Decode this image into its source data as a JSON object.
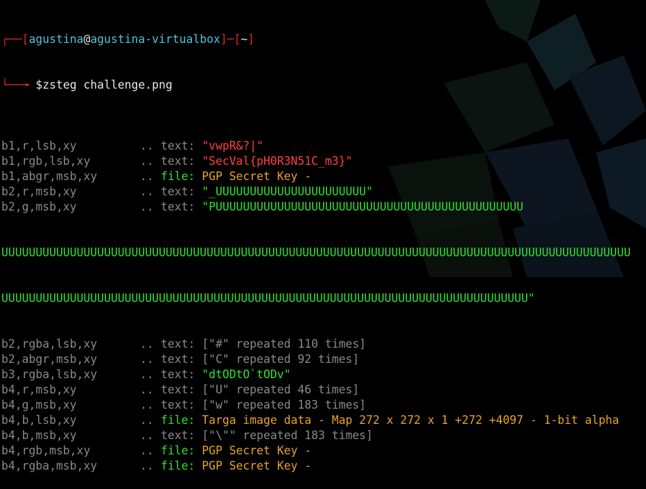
{
  "prompt": {
    "open": "┌──[",
    "user": "agustina",
    "at": "@",
    "host": "agustina-virtualbox",
    "mid": "]─[",
    "dir": "~",
    "close": "]",
    "branch": "└──╼ ",
    "symbol": "$",
    "command": "zsteg challenge.png"
  },
  "rows": [
    {
      "sig": "b1,r,lsb,xy",
      "dots": "..",
      "type": "text:",
      "value": "\"vwpR&?|\"",
      "vcolor": "pred"
    },
    {
      "sig": "b1,rgb,lsb,xy",
      "dots": "..",
      "type": "text:",
      "value": "\"SecVal{pH0R3N51C_m3}\"",
      "vcolor": "pred"
    },
    {
      "sig": "b1,abgr,msb,xy",
      "dots": "..",
      "type": "file:",
      "value": "PGP Secret Key -",
      "vcolor": "orange"
    },
    {
      "sig": "b2,r,msb,xy",
      "dots": "..",
      "type": "text:",
      "value": "\"_UUUUUUUUUUUUUUUUUUUUUU\"",
      "vcolor": "green"
    },
    {
      "sig": "b2,g,msb,xy",
      "dots": "..",
      "type": "text:",
      "value": "\"PUUUUUUUUUUUUUUUUUUUUUUUUUUUUUUUUUUUUUUUUUUUUU",
      "vcolor": "green"
    }
  ],
  "wrap": [
    "UUUUUUUUUUUUUUUUUUUUUUUUUUUUUUUUUUUUUUUUUUUUUUUUUUUUUUUUUUUUUUUUUUUUUUUUUUUUUUUUUUUUUUUUUUUU",
    "UUUUUUUUUUUUUUUUUUUUUUUUUUUUUUUUUUUUUUUUUUUUUUUUUUUUUUUUUUUUUUUUUUUUUUUUUUUUU\""
  ],
  "rows2": [
    {
      "sig": "b2,rgba,lsb,xy",
      "dots": "..",
      "type": "text:",
      "value": "[\"#\" repeated 110 times]",
      "vcolor": "grey"
    },
    {
      "sig": "b2,abgr,msb,xy",
      "dots": "..",
      "type": "text:",
      "value": "[\"C\" repeated 92 times]",
      "vcolor": "grey"
    },
    {
      "sig": "b3,rgba,lsb,xy",
      "dots": "..",
      "type": "text:",
      "value": "\"dtODtO`tODv\"",
      "vcolor": "green"
    },
    {
      "sig": "b4,r,msb,xy",
      "dots": "..",
      "type": "text:",
      "value": "[\"U\" repeated 46 times]",
      "vcolor": "grey"
    },
    {
      "sig": "b4,g,msb,xy",
      "dots": "..",
      "type": "text:",
      "value": "[\"w\" repeated 183 times]",
      "vcolor": "grey"
    },
    {
      "sig": "b4,b,lsb,xy",
      "dots": "..",
      "type": "file:",
      "value": "Targa image data - Map 272 x 272 x 1 +272 +4097 - 1-bit alpha",
      "vcolor": "orange"
    },
    {
      "sig": "b4,b,msb,xy",
      "dots": "..",
      "type": "text:",
      "value": "[\"\\\"\" repeated 183 times]",
      "vcolor": "grey"
    },
    {
      "sig": "b4,rgb,msb,xy",
      "dots": "..",
      "type": "file:",
      "value": "PGP Secret Key -",
      "vcolor": "orange"
    },
    {
      "sig": "b4,rgba,msb,xy",
      "dots": "..",
      "type": "file:",
      "value": "PGP Secret Key -",
      "vcolor": "orange"
    }
  ]
}
